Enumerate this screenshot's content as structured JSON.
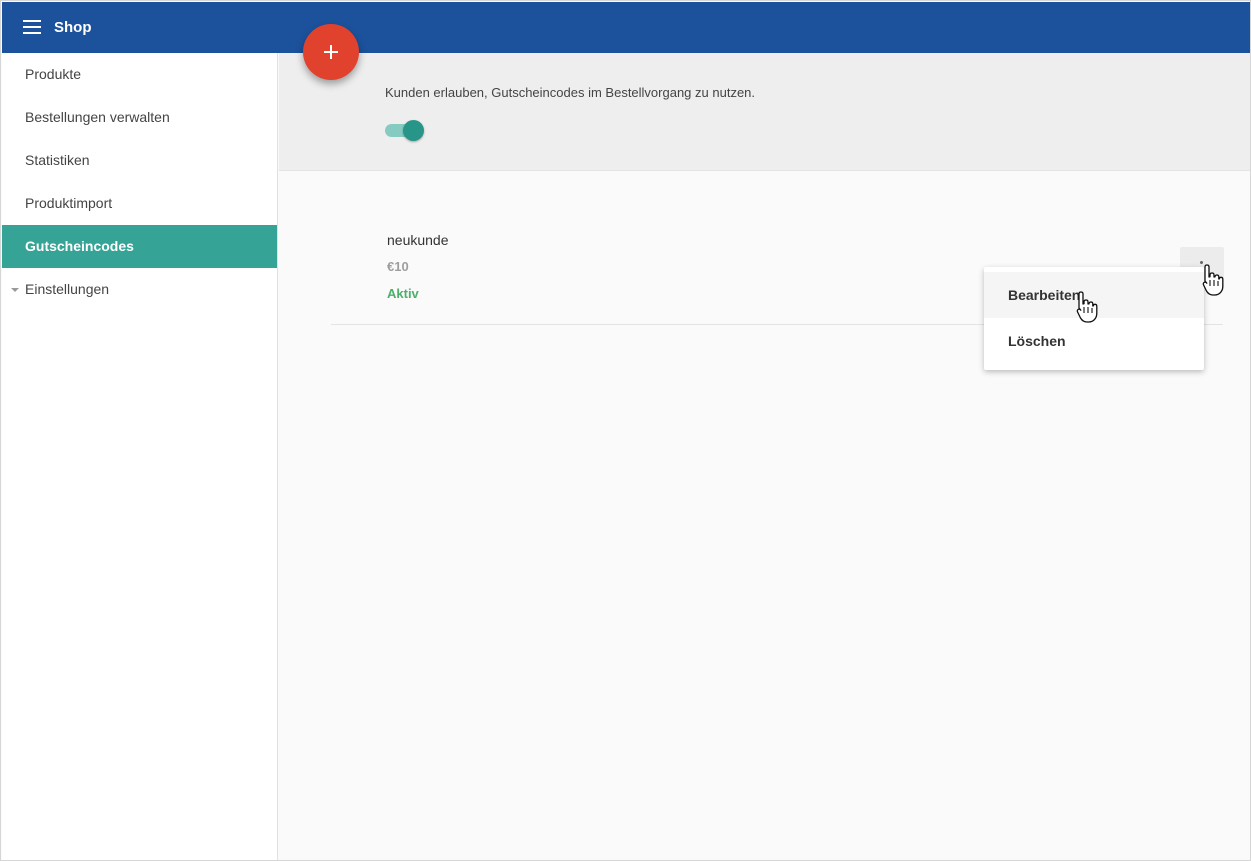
{
  "header": {
    "title": "Shop",
    "menu_icon": "hamburger-menu-icon",
    "color": "#1c529c"
  },
  "sidebar": {
    "items": [
      {
        "label": "Produkte",
        "active": false
      },
      {
        "label": "Bestellungen verwalten",
        "active": false
      },
      {
        "label": "Statistiken",
        "active": false
      },
      {
        "label": "Produktimport",
        "active": false
      },
      {
        "label": "Gutscheincodes",
        "active": true
      },
      {
        "label": "Einstellungen",
        "active": false,
        "expandable": true
      }
    ],
    "active_color": "#36a397"
  },
  "fab": {
    "icon": "plus-icon",
    "color": "#e0422e"
  },
  "settings": {
    "allow_coupons_text": "Kunden erlauben, Gutscheincodes im Bestellvorgang zu nutzen.",
    "allow_coupons_enabled": true
  },
  "coupons": [
    {
      "code": "neukunde",
      "amount": "€10",
      "status": "Aktiv"
    }
  ],
  "context_menu": {
    "items": [
      {
        "label": "Bearbeiten",
        "hovered": true
      },
      {
        "label": "Löschen",
        "hovered": false
      }
    ]
  },
  "status_color": "#4caf6a"
}
